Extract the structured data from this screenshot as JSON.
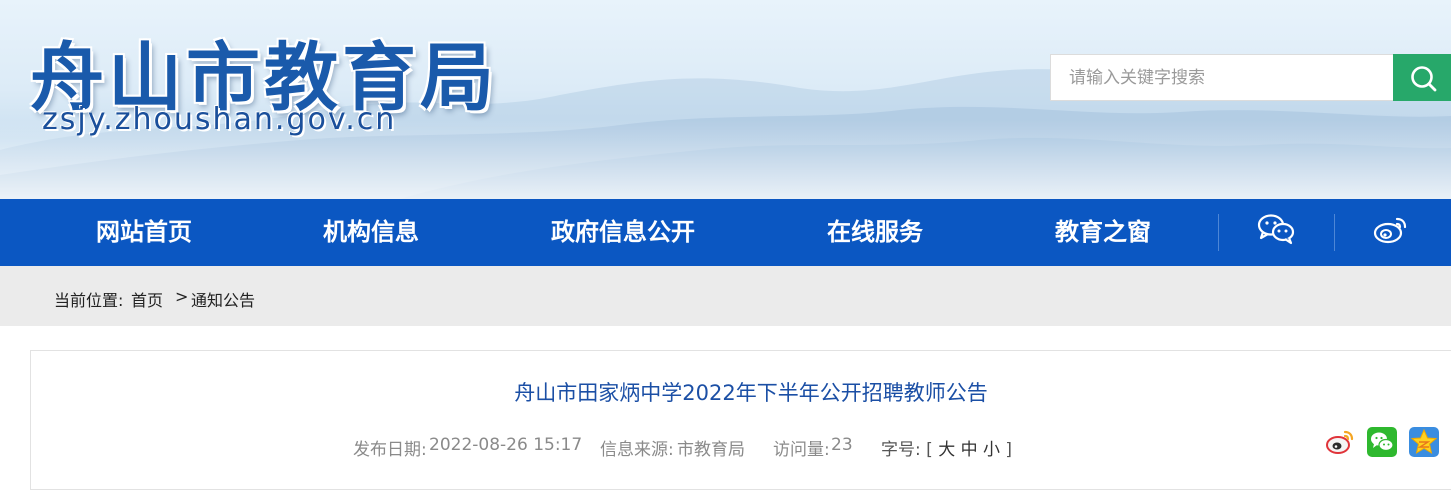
{
  "header": {
    "site_title": "舟山市教育局",
    "site_domain": "zsjy.zhoushan.gov.cn"
  },
  "search": {
    "placeholder": "请输入关键字搜索",
    "icon": "search-icon"
  },
  "nav": {
    "items": [
      "网站首页",
      "机构信息",
      "政府信息公开",
      "在线服务",
      "教育之窗"
    ],
    "icons": [
      "wechat-icon",
      "weibo-icon"
    ]
  },
  "breadcrumb": {
    "label": "当前位置:",
    "home": "首页",
    "separator": ">",
    "current": "通知公告"
  },
  "article": {
    "title": "舟山市田家炳中学2022年下半年公开招聘教师公告",
    "publish_label": "发布日期:",
    "publish_date": "2022-08-26 15:17",
    "source_label": "信息来源:",
    "source": "市教育局",
    "views_label": "访问量:",
    "views": "23",
    "font_size_label": "字号:",
    "font_open": "[",
    "font_large": "大",
    "font_medium": "中",
    "font_small": "小",
    "font_close": "]",
    "share_icons": [
      "weibo-share-icon",
      "wechat-share-icon",
      "qzone-share-icon"
    ]
  },
  "colors": {
    "nav_blue": "#0b57c2",
    "search_green": "#27a86a",
    "title_blue": "#1b4fa5",
    "breadcrumb_bg": "#ebebeb"
  }
}
